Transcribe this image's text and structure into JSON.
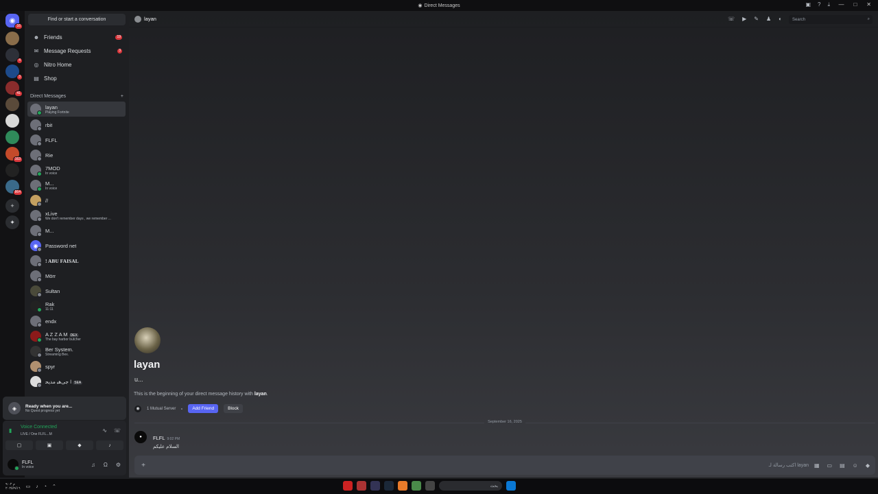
{
  "window": {
    "title": "Direct Messages"
  },
  "sidebar": {
    "search_placeholder": "Find or start a conversation",
    "nav": [
      {
        "label": "Friends",
        "badge": "19",
        "icon": "friends-icon"
      },
      {
        "label": "Message Requests",
        "badge": "3",
        "icon": "envelope-icon"
      },
      {
        "label": "Nitro Home",
        "badge": "",
        "icon": "nitro-icon"
      },
      {
        "label": "Shop",
        "badge": "",
        "icon": "shop-icon"
      }
    ],
    "dm_header": "Direct Messages",
    "dms": [
      {
        "name": "layan",
        "sub": "Playing Fortnite",
        "online": true
      },
      {
        "name": "rbit",
        "sub": ""
      },
      {
        "name": "FLFL",
        "sub": ""
      },
      {
        "name": "Rie",
        "sub": ""
      },
      {
        "name": "7MOD",
        "sub": "In voice",
        "online": true
      },
      {
        "name": "M...",
        "sub": "In voice",
        "online": true
      },
      {
        "name": "//",
        "sub": ""
      },
      {
        "name": "xLive",
        "sub": "We don't remember days , we remember ..."
      },
      {
        "name": "M...",
        "sub": ""
      },
      {
        "name": "Password net",
        "sub": ""
      },
      {
        "name": "! ABU FAISAL",
        "sub": ""
      },
      {
        "name": "Mörr",
        "sub": ""
      },
      {
        "name": "Sultan",
        "sub": ""
      },
      {
        "name": "Rak",
        "sub": "11:11",
        "online": true
      },
      {
        "name": "endx",
        "sub": ""
      },
      {
        "name": "A Z Z A M",
        "sub": "The bay harbor butcher",
        "tag": "DEX",
        "online": true
      },
      {
        "name": "Ber System.",
        "sub": "Streaming Bex."
      },
      {
        "name": "spyr",
        "sub": ""
      },
      {
        "name": "ا ﺟﻰﻫﺒ ﻣﺪﻳﺤ",
        "sub": "",
        "tag": "SEA"
      }
    ]
  },
  "servers": [
    {
      "badge": "16"
    },
    {
      "badge": ""
    },
    {
      "badge": "4"
    },
    {
      "badge": "3"
    },
    {
      "badge": "41"
    },
    {
      "badge": ""
    },
    {
      "badge": ""
    },
    {
      "badge": ""
    },
    {
      "badge": "163"
    },
    {
      "badge": ""
    },
    {
      "badge": "864"
    }
  ],
  "quest": {
    "title": "Ready when you are...",
    "subtitle": "No Quest progress yet"
  },
  "voice": {
    "status": "Voice Connected",
    "channel": "LIVE / One FLFL...M"
  },
  "user": {
    "name": "FLFL",
    "status": "In voice"
  },
  "chat": {
    "recipient": "layan",
    "username": "u...",
    "intro_prefix": "This is the beginning of your direct message history with ",
    "intro_name": "layan",
    "intro_suffix": ".",
    "mutual": "1 Mutual Server",
    "add_friend": "Add Friend",
    "block": "Block",
    "date_divider": "September 16, 2025",
    "message": {
      "author": "FLFL",
      "time": "9:02 PM",
      "text": "السلام عليكم"
    },
    "composer_placeholder": "اكتب رسالة لـ layan",
    "search_placeholder": "Search"
  },
  "taskbar": {
    "search": "بحث",
    "time": "م ٩:٠٢",
    "date": "٢٠٢٥/٩/١٦"
  }
}
